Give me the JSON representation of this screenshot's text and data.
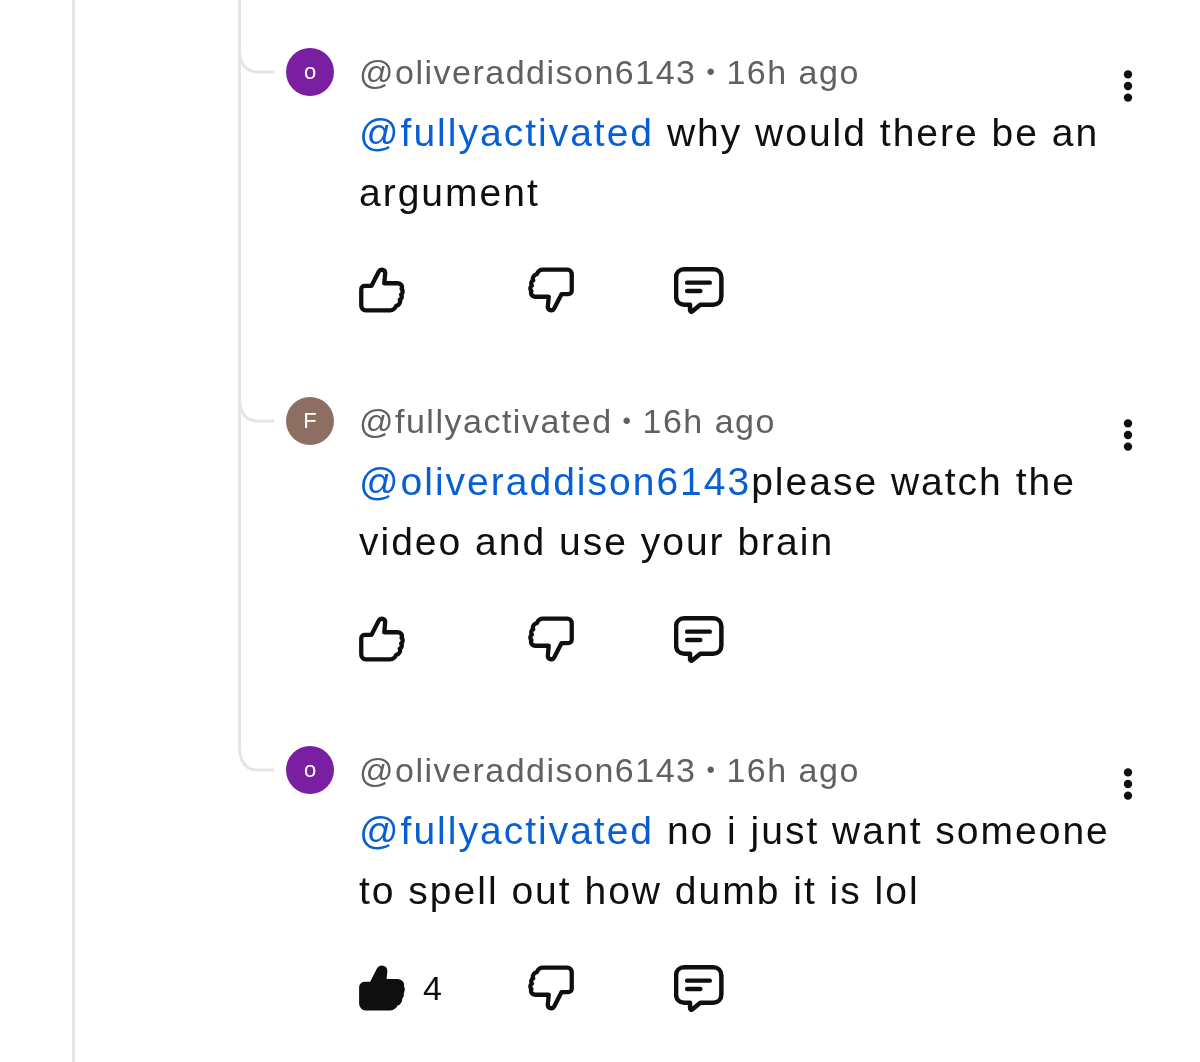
{
  "comments": [
    {
      "avatar": {
        "letter": "o",
        "color": "#7b1fa2"
      },
      "author": "@oliveraddison6143",
      "separator": "•",
      "time": "16h ago",
      "mention": "@fullyactivated",
      "text": " why would there be an argument",
      "liked": false
    },
    {
      "avatar": {
        "letter": "F",
        "color": "#8d6e63"
      },
      "author": "@fullyactivated",
      "separator": "•",
      "time": "16h ago",
      "mention": "@oliveraddison6143",
      "text": "please watch the video and use your brain",
      "liked": false
    },
    {
      "avatar": {
        "letter": "o",
        "color": "#7b1fa2"
      },
      "author": "@oliveraddison6143",
      "separator": "•",
      "time": "16h ago",
      "mention": "@fullyactivated",
      "text": " no i just want someone to spell out how dumb it is lol",
      "liked": true,
      "like_count": "4"
    }
  ]
}
